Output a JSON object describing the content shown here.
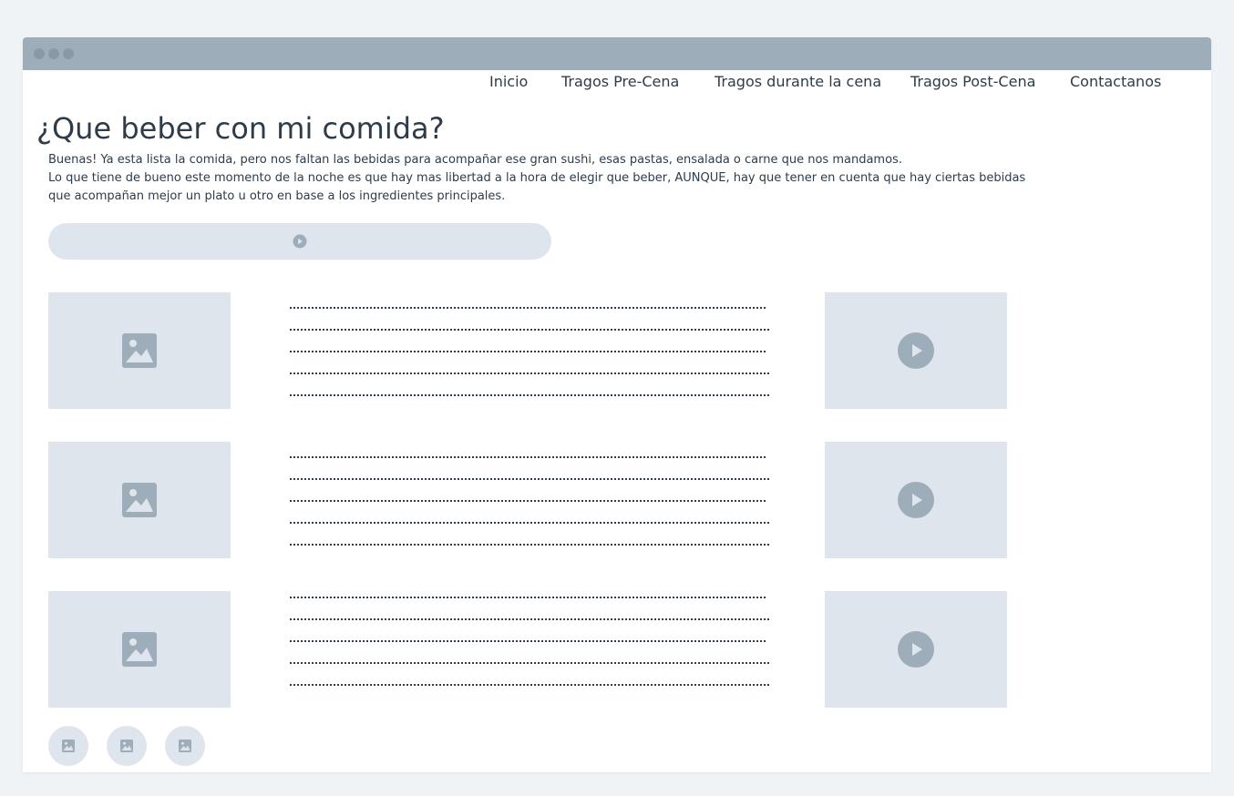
{
  "nav": {
    "items": [
      {
        "label": "Inicio"
      },
      {
        "label": "Tragos Pre-Cena"
      },
      {
        "label": "Tragos durante la cena"
      },
      {
        "label": "Tragos Post-Cena"
      },
      {
        "label": "Contactanos"
      }
    ]
  },
  "main": {
    "title": "¿Que beber con mi comida?",
    "intro": [
      "Buenas! Ya esta lista la comida, pero nos faltan las bebidas para acompañar ese gran sushi, esas pastas, ensalada o carne que nos mandamos.",
      "Lo que tiene de bueno este momento de la noche es que hay mas libertad a la hora de elegir que beber, AUNQUE, hay que tener en cuenta que hay ciertas bebidas que acompañan mejor un plato u otro en base a los ingredientes principales."
    ]
  },
  "audio": {
    "icon": "play-circle-icon"
  },
  "rows": [
    {
      "image_icon": "image-icon",
      "video_icon": "play-icon"
    },
    {
      "image_icon": "image-icon",
      "video_icon": "play-icon"
    },
    {
      "image_icon": "image-icon",
      "video_icon": "play-icon"
    }
  ],
  "thumbnails": [
    {
      "icon": "image-icon"
    },
    {
      "icon": "image-icon"
    },
    {
      "icon": "image-icon"
    }
  ],
  "colors": {
    "background": "#eff3f6",
    "titlebar": "#9eadba",
    "placeholder": "#dfe5ed",
    "icon": "#9eadba",
    "text": "#2e3c49"
  }
}
